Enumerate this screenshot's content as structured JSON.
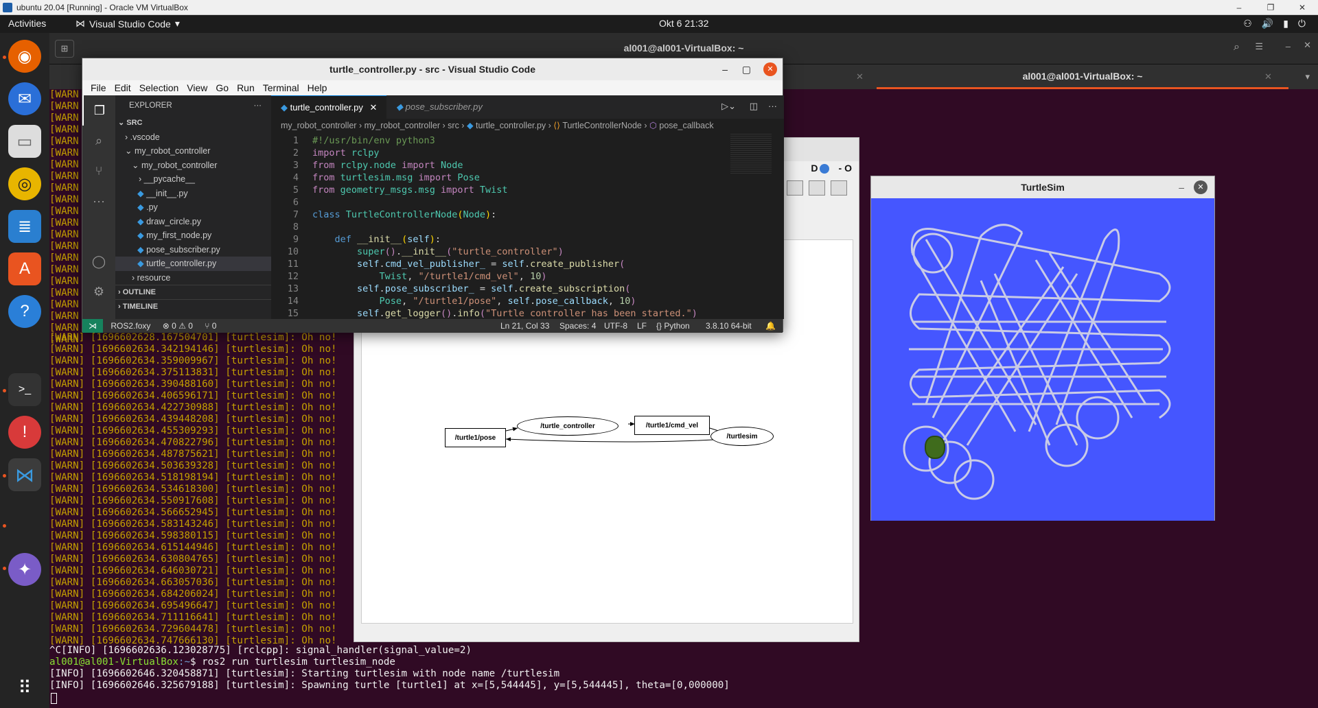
{
  "host": {
    "title": "ubuntu 20.04 [Running] - Oracle VM VirtualBox",
    "controls": [
      "–",
      "❐",
      "✕"
    ]
  },
  "topbar": {
    "activities": "Activities",
    "app": "Visual Studio Code",
    "clock": "Okt 6  21:32"
  },
  "terminal": {
    "title": "al001@al001-VirtualBox: ~",
    "tab2": "al001@al001-VirtualBox: ~",
    "warn_short": "[WARN",
    "warn_lines": [
      "[WARN] [1696602628.167504701] [turtlesim]: Oh no!",
      "[WARN] [1696602634.342194146] [turtlesim]: Oh no!",
      "[WARN] [1696602634.359009967] [turtlesim]: Oh no!",
      "[WARN] [1696602634.375113831] [turtlesim]: Oh no!",
      "[WARN] [1696602634.390488160] [turtlesim]: Oh no!",
      "[WARN] [1696602634.406596171] [turtlesim]: Oh no!",
      "[WARN] [1696602634.422730988] [turtlesim]: Oh no!",
      "[WARN] [1696602634.439448208] [turtlesim]: Oh no!",
      "[WARN] [1696602634.455309293] [turtlesim]: Oh no!",
      "[WARN] [1696602634.470822796] [turtlesim]: Oh no!",
      "[WARN] [1696602634.487875621] [turtlesim]: Oh no!",
      "[WARN] [1696602634.503639328] [turtlesim]: Oh no!",
      "[WARN] [1696602634.518198194] [turtlesim]: Oh no!",
      "[WARN] [1696602634.534618300] [turtlesim]: Oh no!",
      "[WARN] [1696602634.550917608] [turtlesim]: Oh no!",
      "[WARN] [1696602634.566652945] [turtlesim]: Oh no!",
      "[WARN] [1696602634.583143246] [turtlesim]: Oh no!",
      "[WARN] [1696602634.598380115] [turtlesim]: Oh no!",
      "[WARN] [1696602634.615144946] [turtlesim]: Oh no!",
      "[WARN] [1696602634.630804765] [turtlesim]: Oh no!",
      "[WARN] [1696602634.646030721] [turtlesim]: Oh no!",
      "[WARN] [1696602634.663057036] [turtlesim]: Oh no!",
      "[WARN] [1696602634.684206024] [turtlesim]: Oh no!",
      "[WARN] [1696602634.695496647] [turtlesim]: Oh no!",
      "[WARN] [1696602634.711116641] [turtlesim]: Oh no!",
      "[WARN] [1696602634.729604478] [turtlesim]: Oh no!",
      "[WARN] [1696602634.747666130] [turtlesim]: Oh no!"
    ],
    "info1": "^C[INFO] [1696602636.123028775] [rclcpp]: signal_handler(signal_value=2)",
    "prompt_user": "al001@al001-VirtualBox",
    "prompt_path": ":~",
    "prompt_cmd": "$ ros2 run turtlesim turtlesim_node",
    "info2": "[INFO] [1696602646.320458871] [turtlesim]: Starting turtlesim with node name /turtlesim",
    "info3": "[INFO] [1696602646.325679188] [turtlesim]: Spawning turtle [turtle1] at x=[5,544445], y=[5,544445], theta=[0,000000]"
  },
  "rqt": {
    "header_right": "D",
    "header_o": "- O",
    "nodes": {
      "pose": "/turtle1/pose",
      "controller": "/turtle_controller",
      "cmd_vel": "/turtle1/cmd_vel",
      "turtlesim": "/turtlesim"
    }
  },
  "turtlesim": {
    "title": "TurtleSim",
    "bg": "#4556ff"
  },
  "vscode": {
    "title": "turtle_controller.py - src - Visual Studio Code",
    "menu": [
      "File",
      "Edit",
      "Selection",
      "View",
      "Go",
      "Run",
      "Terminal",
      "Help"
    ],
    "explorer": "EXPLORER",
    "tree": [
      ".vscode",
      "my_robot_controller",
      "my_robot_controller",
      "__pycache__",
      "__init__.py",
      ".py",
      "draw_circle.py",
      "my_first_node.py",
      "pose_subscriber.py",
      "turtle_controller.py",
      "resource"
    ],
    "src": "SRC",
    "outline": "OUTLINE",
    "timeline": "TIMELINE",
    "tabs": [
      "turtle_controller.py",
      "pose_subscriber.py"
    ],
    "breadcrumb": [
      "my_robot_controller",
      "my_robot_controller",
      "src",
      "turtle_controller.py",
      "TurtleControllerNode",
      "pose_callback"
    ],
    "status": {
      "branch": "ROS2.foxy",
      "problems": "⊗ 0 ⚠ 0",
      "ports": "⑂ 0",
      "pos": "Ln 21, Col 33",
      "spaces": "Spaces: 4",
      "enc": "UTF-8",
      "eol": "LF",
      "lang": "Python",
      "ver": "3.8.10 64-bit"
    }
  }
}
